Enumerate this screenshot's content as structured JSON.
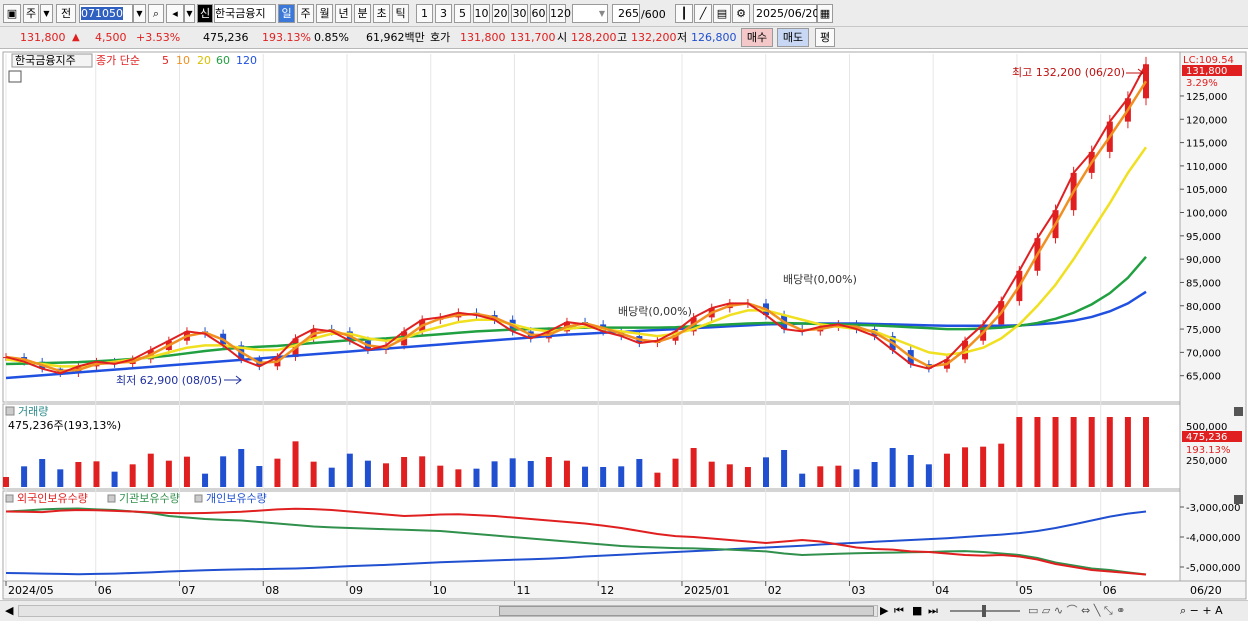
{
  "toolbar": {
    "period": "주",
    "prev": "전",
    "code": "071050",
    "sin": "신",
    "name": "한국금융지",
    "periods": [
      "일",
      "주",
      "월",
      "년",
      "분",
      "초",
      "틱"
    ],
    "intervals": [
      "1",
      "3",
      "5",
      "10",
      "20",
      "30",
      "60",
      "120"
    ],
    "count": "265",
    "count_total": "/600",
    "date": "2025/06/20"
  },
  "info": {
    "price": "131,800",
    "change": "4,500",
    "change_pct": "+3.53%",
    "volume": "475,236",
    "vol_ratio": "193.13%",
    "turnover": "0.85%",
    "amount": "61,962백만",
    "hoga_label": "호가",
    "ask": "131,800",
    "bid": "131,700",
    "open_label": "시",
    "open": "128,200",
    "high_label": "고",
    "high": "132,200",
    "low_label": "저",
    "low": "126,800",
    "buy": "매수",
    "sell": "매도",
    "pyeong": "평"
  },
  "colors": {
    "red": "#e02020",
    "blue": "#2050d0",
    "ma5": "#e02020",
    "ma10": "#f09020",
    "ma20": "#f0e020",
    "ma60": "#20a040",
    "ma120": "#2050e0",
    "green": "#30904c"
  },
  "chart_data": {
    "type": "line",
    "price_panel": {
      "title": "한국금융지주",
      "legend_label": "종가 단순",
      "ma_periods": [
        "5",
        "10",
        "20",
        "60",
        "120"
      ],
      "y_ticks": [
        65000,
        70000,
        75000,
        80000,
        85000,
        90000,
        95000,
        100000,
        105000,
        110000,
        115000,
        120000,
        125000
      ],
      "y_tick_labels": [
        "65,000",
        "70,000",
        "75,000",
        "80,000",
        "85,000",
        "90,000",
        "95,000",
        "100,000",
        "105,000",
        "110,000",
        "115,000",
        "120,000",
        "125,000"
      ],
      "ylim": [
        60000,
        134000
      ],
      "close_weekly": [
        69000,
        68000,
        66500,
        65500,
        67000,
        68000,
        67500,
        68500,
        70500,
        72500,
        74500,
        74000,
        71500,
        68500,
        67000,
        69000,
        73000,
        75000,
        74500,
        72500,
        70500,
        71500,
        74500,
        77000,
        77500,
        78500,
        78000,
        77000,
        74500,
        73000,
        74500,
        76500,
        76000,
        74500,
        73500,
        72000,
        72500,
        74500,
        77500,
        79500,
        80500,
        80500,
        78000,
        75000,
        74500,
        75500,
        76000,
        75000,
        73500,
        70500,
        67500,
        66500,
        68500,
        72500,
        76000,
        81000,
        87500,
        94500,
        100500,
        108500,
        113000,
        119500,
        124500,
        131800
      ],
      "ma20_weekly": [
        68500,
        68000,
        67500,
        67000,
        67000,
        67500,
        68000,
        68500,
        69000,
        70000,
        71000,
        71500,
        71500,
        71000,
        70500,
        70500,
        71500,
        73000,
        74000,
        74000,
        73000,
        72500,
        73000,
        74500,
        75500,
        76500,
        77000,
        77000,
        76000,
        75000,
        74500,
        75000,
        75500,
        75000,
        74500,
        74000,
        73500,
        74000,
        75000,
        76500,
        78000,
        79000,
        79000,
        78000,
        77000,
        76000,
        75500,
        75000,
        74500,
        73000,
        71500,
        70000,
        69500,
        70000,
        71000,
        73000,
        76000,
        80000,
        84500,
        90000,
        96000,
        102000,
        108500,
        114000
      ],
      "ma60_weekly": [
        67500,
        67600,
        67700,
        67800,
        67900,
        68100,
        68300,
        68600,
        68900,
        69300,
        69800,
        70300,
        70700,
        71000,
        71200,
        71400,
        71700,
        72000,
        72300,
        72600,
        72800,
        73000,
        73300,
        73600,
        73900,
        74200,
        74500,
        74700,
        74900,
        75000,
        75100,
        75200,
        75300,
        75300,
        75300,
        75300,
        75300,
        75400,
        75600,
        75800,
        76000,
        76200,
        76300,
        76300,
        76200,
        76100,
        76000,
        75900,
        75800,
        75600,
        75400,
        75200,
        75000,
        75000,
        75100,
        75300,
        75700,
        76300,
        77200,
        78500,
        80300,
        82700,
        86000,
        90500
      ],
      "ma120_weekly": [
        64500,
        64800,
        65100,
        65400,
        65700,
        66000,
        66300,
        66600,
        66900,
        67200,
        67500,
        67800,
        68100,
        68400,
        68700,
        69000,
        69300,
        69600,
        69900,
        70200,
        70500,
        70800,
        71100,
        71400,
        71700,
        72000,
        72300,
        72600,
        72900,
        73200,
        73500,
        73800,
        74000,
        74200,
        74400,
        74600,
        74800,
        75000,
        75200,
        75400,
        75600,
        75800,
        76000,
        76100,
        76200,
        76200,
        76200,
        76200,
        76100,
        76000,
        75900,
        75800,
        75700,
        75700,
        75700,
        75700,
        75800,
        76000,
        76300,
        76800,
        77600,
        78800,
        80500,
        83000
      ],
      "last_label": "131,800",
      "last_pct": "3.29%",
      "lc_label": "LC:109.54",
      "annotations": [
        {
          "label": "최고 132,200 (06/20)",
          "value": 132200
        },
        {
          "label": "최저 62,900 (08/05)",
          "value": 62900
        },
        {
          "label": "배당락(0,00%)",
          "value": 76000
        },
        {
          "label": "배당락(0,00%)",
          "value": 82000
        }
      ]
    },
    "volume_panel": {
      "title": "거래량",
      "value_label": "475,236주(193,13%)",
      "y_labels": [
        "500,000",
        "250,000"
      ],
      "last_label": "475,236",
      "last_pct": "193.13%"
    },
    "holdings_panel": {
      "legend": [
        "외국인보유수량",
        "기관보유수량",
        "개인보유수량"
      ],
      "y_ticks": [
        -3000000,
        -4000000,
        -5000000
      ],
      "y_tick_labels": [
        "-3,000,000",
        "-4,000,000",
        "-5,000,000"
      ],
      "ylim": [
        -5400000,
        -2600000
      ],
      "foreign_weekly": [
        -3150000,
        -3160000,
        -3170000,
        -3120000,
        -3100000,
        -3110000,
        -3130000,
        -3150000,
        -3180000,
        -3200000,
        -3210000,
        -3200000,
        -3180000,
        -3160000,
        -3120000,
        -3080000,
        -3060000,
        -3070000,
        -3100000,
        -3150000,
        -3200000,
        -3250000,
        -3300000,
        -3280000,
        -3250000,
        -3240000,
        -3270000,
        -3300000,
        -3350000,
        -3400000,
        -3450000,
        -3500000,
        -3550000,
        -3620000,
        -3700000,
        -3800000,
        -3900000,
        -3970000,
        -4000000,
        -4050000,
        -4100000,
        -4150000,
        -4200000,
        -4150000,
        -4100000,
        -4150000,
        -4250000,
        -4350000,
        -4400000,
        -4420000,
        -4480000,
        -4500000,
        -4550000,
        -4600000,
        -4620000,
        -4600000,
        -4650000,
        -4750000,
        -4900000,
        -5000000,
        -5100000,
        -5150000,
        -5200000,
        -5250000
      ],
      "institution_weekly": [
        -3150000,
        -3120000,
        -3080000,
        -3060000,
        -3050000,
        -3080000,
        -3100000,
        -3150000,
        -3200000,
        -3300000,
        -3350000,
        -3400000,
        -3430000,
        -3450000,
        -3500000,
        -3550000,
        -3600000,
        -3650000,
        -3680000,
        -3700000,
        -3720000,
        -3740000,
        -3760000,
        -3780000,
        -3800000,
        -3850000,
        -3900000,
        -3950000,
        -4000000,
        -4050000,
        -4100000,
        -4150000,
        -4200000,
        -4250000,
        -4300000,
        -4330000,
        -4350000,
        -4370000,
        -4380000,
        -4400000,
        -4420000,
        -4450000,
        -4480000,
        -4550000,
        -4600000,
        -4580000,
        -4560000,
        -4540000,
        -4530000,
        -4520000,
        -4510000,
        -4500000,
        -4480000,
        -4470000,
        -4500000,
        -4550000,
        -4600000,
        -4700000,
        -4850000,
        -4950000,
        -5050000,
        -5100000,
        -5180000,
        -5250000
      ],
      "individual_weekly": [
        -5200000,
        -5210000,
        -5220000,
        -5230000,
        -5240000,
        -5230000,
        -5220000,
        -5200000,
        -5180000,
        -5150000,
        -5130000,
        -5110000,
        -5090000,
        -5080000,
        -5070000,
        -5060000,
        -5050000,
        -5030000,
        -5000000,
        -4970000,
        -4950000,
        -4930000,
        -4900000,
        -4870000,
        -4840000,
        -4820000,
        -4800000,
        -4780000,
        -4760000,
        -4740000,
        -4720000,
        -4690000,
        -4650000,
        -4620000,
        -4590000,
        -4560000,
        -4530000,
        -4500000,
        -4470000,
        -4440000,
        -4410000,
        -4380000,
        -4350000,
        -4320000,
        -4290000,
        -4250000,
        -4220000,
        -4190000,
        -4160000,
        -4130000,
        -4100000,
        -4070000,
        -4040000,
        -4000000,
        -3960000,
        -3920000,
        -3870000,
        -3800000,
        -3700000,
        -3580000,
        -3450000,
        -3320000,
        -3220000,
        -3150000
      ]
    },
    "x_labels": [
      "2024/05",
      "06",
      "07",
      "08",
      "09",
      "10",
      "11",
      "12",
      "2025/01",
      "02",
      "03",
      "04",
      "05",
      "06"
    ],
    "x_right_label": "06/20"
  }
}
